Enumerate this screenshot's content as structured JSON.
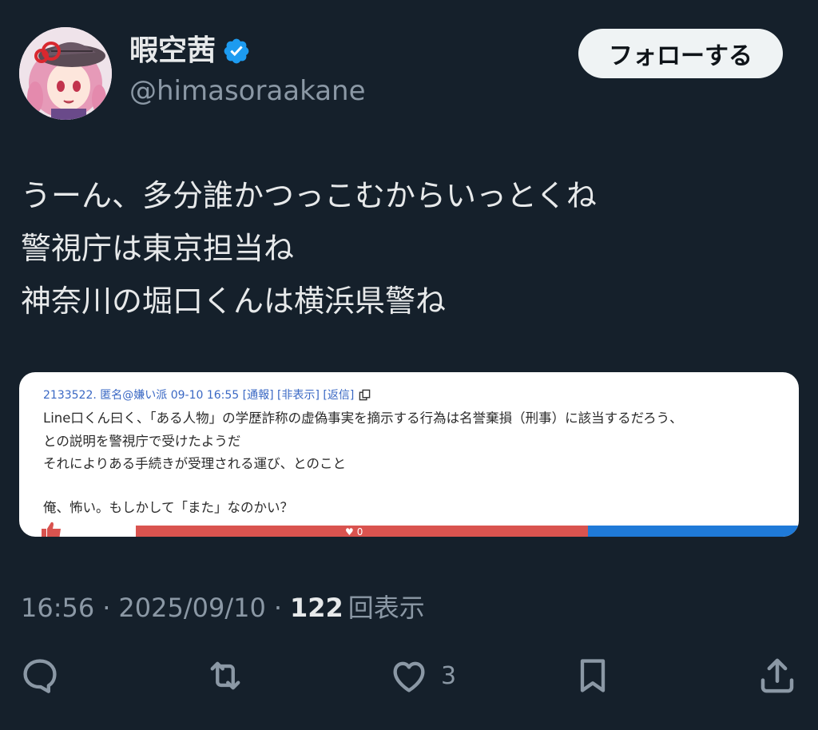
{
  "author": {
    "display_name": "暇空茜",
    "handle": "@himasoraakane"
  },
  "follow_label": "フォローする",
  "tweet_lines": [
    "うーん、多分誰かつっこむからいっとくね",
    "警視庁は東京担当ね",
    "神奈川の堀口くんは横浜県警ね"
  ],
  "media": {
    "post_meta": "2133522. 匿名@嫌い派 09-10 16:55 [通報] [非表示] [返信]",
    "post_lines": [
      "Line口くん曰く、「ある人物」の学歴詐称の虚偽事実を摘示する行為は名誉棄損（刑事）に該当するだろう、",
      "との説明を警視庁で受けたようだ",
      "それによりある手続きが受理される運び、とのこと",
      "俺、怖い。もしかして「また」なのかい？"
    ],
    "vote_count": "0"
  },
  "timestamp": {
    "time": "16:56",
    "date": "2025/09/10",
    "separator": "·",
    "views_count": "122",
    "views_label": "回表示"
  },
  "actions": {
    "likes_count": "3"
  }
}
